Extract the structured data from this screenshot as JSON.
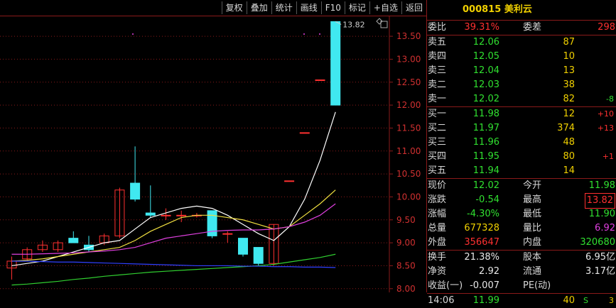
{
  "toolbar": {
    "items": [
      "复权",
      "叠加",
      "统计",
      "画线",
      "F10",
      "标记",
      "+自选",
      "返回"
    ]
  },
  "chart": {
    "high_marker": "13.82",
    "y_labels": [
      "13.50",
      "13.00",
      "12.50",
      "12.00",
      "11.50",
      "11.00",
      "10.50",
      "10.00",
      "9.50",
      "9.00",
      "8.50",
      "8.00"
    ],
    "colors": {
      "up": "#ff3030",
      "down": "#40e8f0",
      "ma5": "#ffffff",
      "ma10": "#f0e040",
      "ma20": "#e040e0",
      "ma60": "#30d030",
      "ma120": "#3040ff",
      "grid": "#8a1a1a"
    }
  },
  "chart_data": {
    "type": "candlestick",
    "ylim": [
      7.95,
      13.95
    ],
    "candles": [
      {
        "o": 8.45,
        "c": 8.6,
        "h": 8.7,
        "l": 8.2
      },
      {
        "o": 8.65,
        "c": 8.85,
        "h": 8.9,
        "l": 8.6
      },
      {
        "o": 8.85,
        "c": 8.95,
        "h": 9.05,
        "l": 8.8
      },
      {
        "o": 8.85,
        "c": 9.0,
        "h": 9.05,
        "l": 8.8
      },
      {
        "o": 9.1,
        "c": 9.0,
        "h": 9.25,
        "l": 9.0
      },
      {
        "o": 8.95,
        "c": 8.85,
        "h": 9.15,
        "l": 8.8
      },
      {
        "o": 9.0,
        "c": 9.15,
        "h": 9.2,
        "l": 8.95
      },
      {
        "o": 9.15,
        "c": 10.15,
        "h": 10.2,
        "l": 9.1
      },
      {
        "o": 10.3,
        "c": 9.95,
        "h": 11.1,
        "l": 9.9
      },
      {
        "o": 9.65,
        "c": 9.6,
        "h": 10.25,
        "l": 9.55
      },
      {
        "o": 9.6,
        "c": 9.6,
        "h": 9.75,
        "l": 9.5
      },
      {
        "o": 9.6,
        "c": 9.6,
        "h": 9.7,
        "l": 9.45
      },
      {
        "o": 9.6,
        "c": 9.6,
        "h": 9.65,
        "l": 9.55
      },
      {
        "o": 9.7,
        "c": 9.15,
        "h": 9.7,
        "l": 9.1
      },
      {
        "o": 9.2,
        "c": 9.2,
        "h": 9.25,
        "l": 9.0
      },
      {
        "o": 9.1,
        "c": 8.75,
        "h": 9.1,
        "l": 8.7
      },
      {
        "o": 8.9,
        "c": 8.55,
        "h": 8.9,
        "l": 8.5
      },
      {
        "o": 8.55,
        "c": 9.4,
        "h": 9.4,
        "l": 8.5
      },
      {
        "o": 10.35,
        "c": 10.35,
        "h": 10.35,
        "l": 10.35
      },
      {
        "o": 11.4,
        "c": 11.4,
        "h": 11.4,
        "l": 11.4
      },
      {
        "o": 12.55,
        "c": 12.55,
        "h": 12.55,
        "l": 12.55
      },
      {
        "o": 13.82,
        "c": 12.0,
        "h": 13.82,
        "l": 12.0
      }
    ],
    "ma5": [
      8.5,
      8.55,
      8.6,
      8.7,
      8.8,
      8.9,
      9.0,
      9.05,
      9.3,
      9.55,
      9.65,
      9.75,
      9.8,
      9.75,
      9.6,
      9.4,
      9.2,
      9.05,
      9.35,
      9.95,
      10.8,
      11.85
    ],
    "ma10": [
      8.6,
      8.62,
      8.65,
      8.7,
      8.75,
      8.8,
      8.85,
      8.9,
      9.05,
      9.25,
      9.4,
      9.55,
      9.6,
      9.6,
      9.55,
      9.5,
      9.4,
      9.3,
      9.35,
      9.6,
      9.85,
      10.15
    ],
    "ma20": [
      8.75,
      8.75,
      8.76,
      8.77,
      8.78,
      8.8,
      8.82,
      8.85,
      8.9,
      9.0,
      9.1,
      9.15,
      9.2,
      9.25,
      9.27,
      9.28,
      9.28,
      9.3,
      9.35,
      9.45,
      9.6,
      9.85
    ],
    "ma60": [
      8.08,
      8.1,
      8.13,
      8.16,
      8.2,
      8.23,
      8.27,
      8.3,
      8.33,
      8.36,
      8.38,
      8.4,
      8.42,
      8.44,
      8.46,
      8.48,
      8.5,
      8.53,
      8.58,
      8.63,
      8.68,
      8.75
    ],
    "ma120": [
      8.6,
      8.6,
      8.59,
      8.58,
      8.58,
      8.57,
      8.56,
      8.55,
      8.54,
      8.53,
      8.52,
      8.51,
      8.5,
      8.5,
      8.5,
      8.49,
      8.49,
      8.48,
      8.48,
      8.47,
      8.47,
      8.46
    ]
  },
  "quote": {
    "code": "000815",
    "name": "美利云",
    "weibi_label": "委比",
    "weibi_value": "39.31%",
    "weicha_label": "委差",
    "weicha_value": "298",
    "asks": [
      {
        "label": "卖五",
        "price": "12.06",
        "vol": "87",
        "chg": ""
      },
      {
        "label": "卖四",
        "price": "12.05",
        "vol": "10",
        "chg": ""
      },
      {
        "label": "卖三",
        "price": "12.04",
        "vol": "13",
        "chg": ""
      },
      {
        "label": "卖二",
        "price": "12.03",
        "vol": "38",
        "chg": ""
      },
      {
        "label": "卖一",
        "price": "12.02",
        "vol": "82",
        "chg": "-8"
      }
    ],
    "bids": [
      {
        "label": "买一",
        "price": "11.98",
        "vol": "12",
        "chg": "+10"
      },
      {
        "label": "买二",
        "price": "11.97",
        "vol": "374",
        "chg": "+13"
      },
      {
        "label": "买三",
        "price": "11.96",
        "vol": "48",
        "chg": ""
      },
      {
        "label": "买四",
        "price": "11.95",
        "vol": "80",
        "chg": "+1"
      },
      {
        "label": "买五",
        "price": "11.94",
        "vol": "14",
        "chg": ""
      }
    ],
    "stats": [
      {
        "l1": "现价",
        "v1": "12.02",
        "l2": "今开",
        "v2": "11.98"
      },
      {
        "l1": "涨跌",
        "v1": "-0.54",
        "l2": "最高",
        "v2": "13.82"
      },
      {
        "l1": "涨幅",
        "v1": "-4.30%",
        "l2": "最低",
        "v2": "11.90"
      },
      {
        "l1": "总量",
        "v1": "677328",
        "l2": "量比",
        "v2": "6.92"
      },
      {
        "l1": "外盘",
        "v1": "356647",
        "l2": "内盘",
        "v2": "320680"
      }
    ],
    "stats2": [
      {
        "l1": "换手",
        "v1": "21.38%",
        "l2": "股本",
        "v2": "6.95亿"
      },
      {
        "l1": "净资",
        "v1": "2.92",
        "l2": "流通",
        "v2": "3.17亿"
      },
      {
        "l1": "收益(一)",
        "v1": "-0.007",
        "l2": "PE(动)",
        "v2": ""
      }
    ],
    "tick": {
      "time": "14:06",
      "price": "11.99",
      "vol": "40",
      "flag": "S",
      "num": "3"
    }
  }
}
